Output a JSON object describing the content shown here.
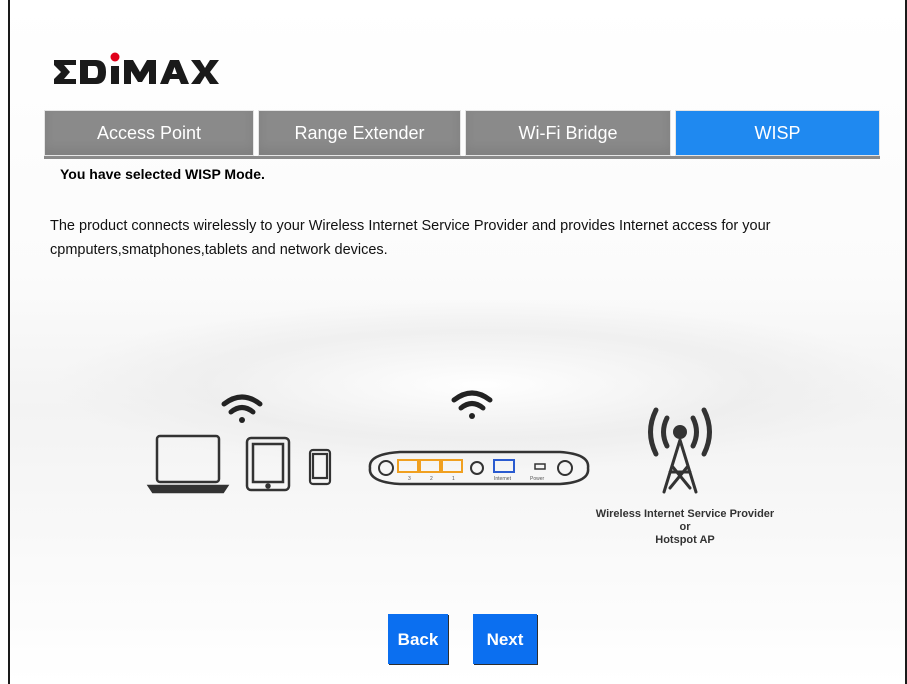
{
  "brand": {
    "logo_text": "EDIMAX",
    "logo_icon": "edimax-logo"
  },
  "tabs": [
    {
      "label": "Access Point",
      "active": false
    },
    {
      "label": "Range Extender",
      "active": false
    },
    {
      "label": "Wi-Fi Bridge",
      "active": false
    },
    {
      "label": "WISP",
      "active": true
    }
  ],
  "content": {
    "heading": "You have selected WISP Mode.",
    "description": "The product connects wirelessly to your Wireless Internet Service Provider and provides Internet access for your cpmputers,smatphones,tablets and network devices."
  },
  "diagram": {
    "icons": [
      "laptop-icon",
      "tablet-icon",
      "phone-icon",
      "router-icon",
      "wifi-icon",
      "antenna-tower-icon"
    ],
    "router_port_labels": [
      "3",
      "2",
      "1",
      "Internet",
      "Power"
    ],
    "caption_line1": "Wireless Internet Service Provider",
    "caption_line2": "or",
    "caption_line3": "Hotspot AP"
  },
  "buttons": {
    "back_label": "Back",
    "next_label": "Next"
  },
  "colors": {
    "accent": "#1f89f0",
    "button": "#0b6ff0",
    "tab_inactive": "#8a8a8a",
    "logo_dot": "#e0001a"
  }
}
